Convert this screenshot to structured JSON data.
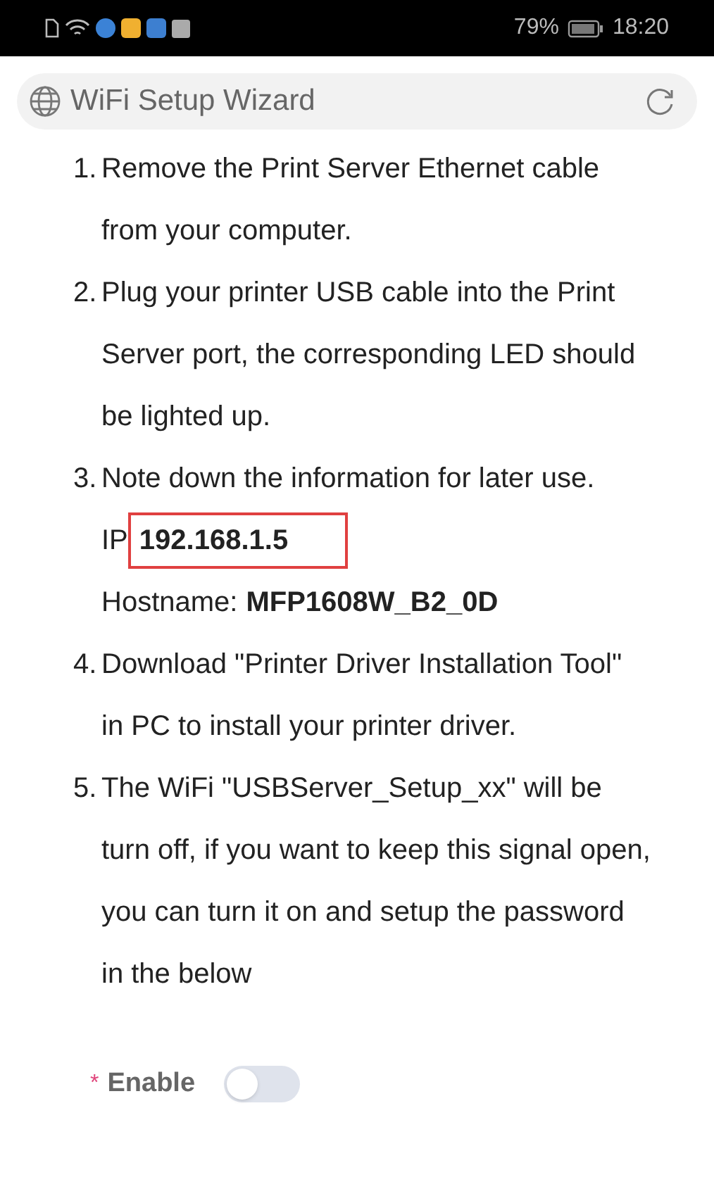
{
  "status_bar": {
    "battery": "79%",
    "time": "18:20"
  },
  "header": {
    "title": "WiFi Setup Wizard"
  },
  "steps": [
    {
      "number": "1.",
      "text": "Remove the Print Server Ethernet cable from your computer."
    },
    {
      "number": "2.",
      "text": "Plug your printer USB cable into the Print Server port, the corresponding LED should be lighted up."
    },
    {
      "number": "3.",
      "text": "Note down the information for later use.",
      "details": [
        {
          "label": "IP",
          "value": "192.168.1.5",
          "highlighted": true
        },
        {
          "label": "Hostname:",
          "value": "MFP1608W_B2_0D",
          "highlighted": false
        }
      ]
    },
    {
      "number": "4.",
      "text": "Download \"Printer Driver Installation Tool\" in PC to install your printer driver."
    },
    {
      "number": "5.",
      "text": "The WiFi \"USBServer_Setup_xx\" will be turn off, if you want to keep this signal open, you can turn it on and setup the password in the below"
    }
  ],
  "enable": {
    "required_mark": "*",
    "label": "Enable",
    "on": false
  }
}
